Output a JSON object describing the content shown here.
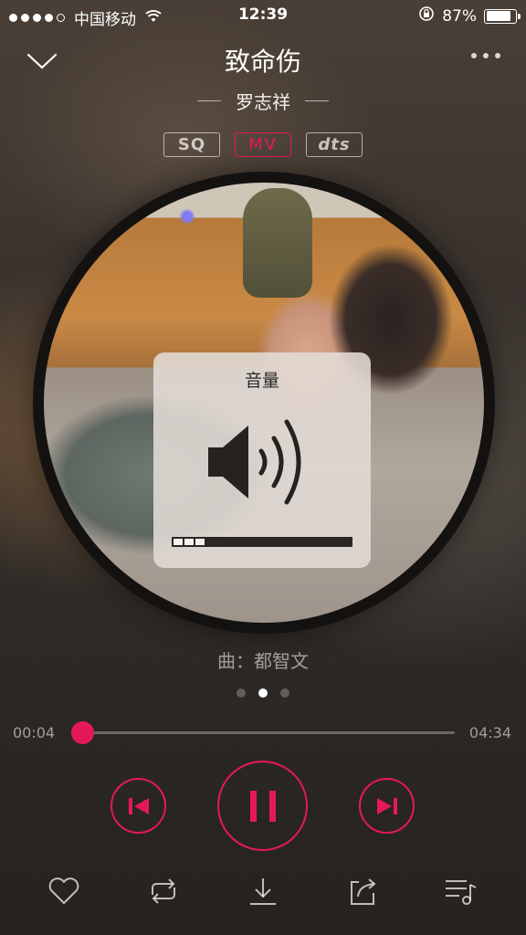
{
  "status_bar": {
    "carrier": "中国移动",
    "time": "12:39",
    "battery_percent": "87%",
    "battery_level": 0.87,
    "signal_dots_filled": 4,
    "signal_dots_total": 5,
    "icons": [
      "wifi-icon",
      "rotation-lock-icon",
      "battery-icon"
    ]
  },
  "header": {
    "title": "致命伤",
    "artist": "罗志祥",
    "icons": [
      "chevron-down-icon",
      "more-icon"
    ]
  },
  "badges": [
    {
      "label": "SQ",
      "active": false
    },
    {
      "label": "MV",
      "active": true
    },
    {
      "label": "dts",
      "active": false
    }
  ],
  "volume_hud": {
    "title": "音量",
    "level": 0.2,
    "icon": "speaker-icon"
  },
  "composer": "曲：都智文",
  "pager": {
    "pages": 3,
    "active_index": 1
  },
  "progress": {
    "current": "00:04",
    "total": "04:34",
    "fraction": 0.015
  },
  "controls": {
    "icons": [
      "previous-icon",
      "pause-icon",
      "next-icon"
    ]
  },
  "bottom_bar": {
    "icons": [
      "heart-icon",
      "repeat-icon",
      "download-icon",
      "share-icon",
      "playlist-icon"
    ]
  },
  "colors": {
    "accent": "#e5195a",
    "hud_background": "#e2dcd6"
  }
}
